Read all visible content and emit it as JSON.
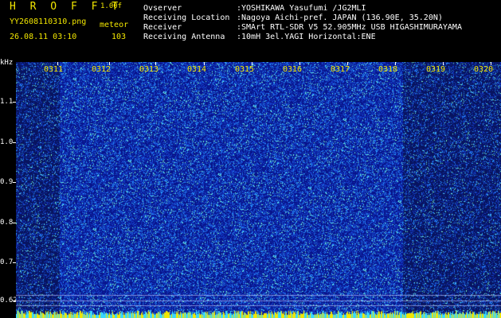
{
  "header": {
    "brand": "H R O F F T",
    "version": "1.00f",
    "filename": "YY2608110310.png",
    "mode": "meteor",
    "datetime": "26.08.11 03:10",
    "count": "103",
    "fields": [
      {
        "label": "Ovserver",
        "value": ":YOSHIKAWA Yasufumi /JG2MLI"
      },
      {
        "label": "Receiving Location",
        "value": ":Nagoya Aichi-pref. JAPAN (136.90E, 35.20N)"
      },
      {
        "label": "Receiver",
        "value": ":SMArt RTL-SDR V5 52.905MHz USB HIGASHIMURAYAMA"
      },
      {
        "label": "Receiving Antenna",
        "value": ":10mH 3el.YAGI Horizontal:ENE"
      }
    ]
  },
  "spectrogram": {
    "y_unit": "kHz",
    "y_ticks": [
      "1.1",
      "1.0",
      "0.9",
      "0.8",
      "0.7",
      "0.62"
    ],
    "x_ticks": [
      "0311",
      "0312",
      "0313",
      "0314",
      "0315",
      "0316",
      "0317",
      "0318",
      "0319",
      "0320"
    ],
    "colors": {
      "background": "#0a1fa8",
      "dark": "#05105a",
      "bright": "#3aa0ff",
      "hot": "#7fffd0",
      "yellow": "#f2e600"
    }
  }
}
